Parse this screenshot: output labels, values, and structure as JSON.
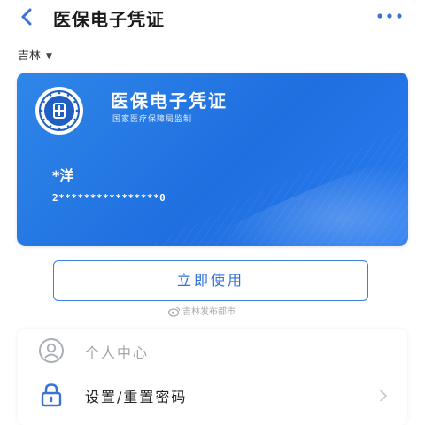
{
  "header": {
    "title": "医保电子凭证"
  },
  "region": {
    "label": "吉林"
  },
  "card": {
    "title": "医保电子凭证",
    "issuer": "国家医疗保障局监制",
    "holder_name": "*洋",
    "holder_id": "2****************0"
  },
  "actions": {
    "use_label": "立即使用"
  },
  "watermark": {
    "text": "吉林发布都市"
  },
  "menu": {
    "items": [
      {
        "label": "个人中心",
        "icon": "person-icon"
      },
      {
        "label": "设置/重置密码",
        "icon": "lock-icon"
      }
    ]
  },
  "colors": {
    "card_blue": "#1f6fe0",
    "accent": "#2f6fd8",
    "icon_blue": "#3a73d6",
    "icon_gray": "#a9afb8"
  }
}
